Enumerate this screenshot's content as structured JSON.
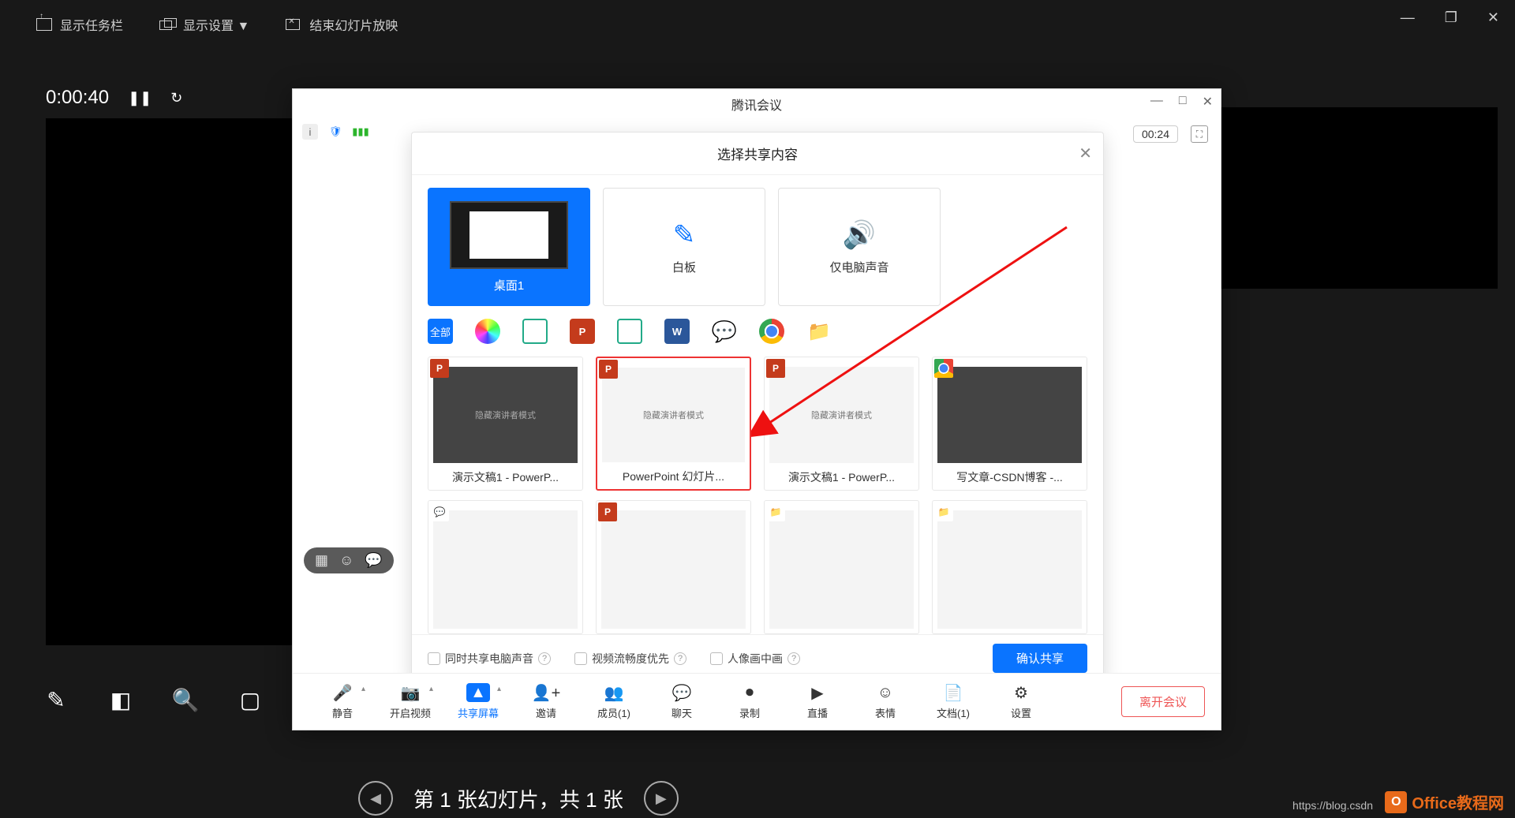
{
  "ppt": {
    "show_taskbar": "显示任务栏",
    "display_settings": "显示设置 ▼",
    "end_show": "结束幻灯片放映",
    "timer": "0:00:40",
    "slide_count": "第 1 张幻灯片，共 1 张"
  },
  "window_controls": {
    "min": "—",
    "max": "❐",
    "close": "✕"
  },
  "meeting": {
    "title": "腾讯会议",
    "timer": "00:24",
    "dialog": {
      "title": "选择共享内容",
      "options": {
        "desktop": "桌面1",
        "whiteboard": "白板",
        "audio_only": "仅电脑声音"
      },
      "filter_all": "全部",
      "windows": [
        {
          "label": "演示文稿1 - PowerP...",
          "badge": "ppt",
          "thumb": "隐藏演讲者模式",
          "style": "dark"
        },
        {
          "label": "PowerPoint 幻灯片...",
          "badge": "ppt",
          "thumb": "隐藏演讲者模式",
          "style": "white",
          "highlight": true
        },
        {
          "label": "演示文稿1 - PowerP...",
          "badge": "ppt",
          "thumb": "隐藏演讲者模式",
          "style": "white"
        },
        {
          "label": "写文章-CSDN博客 -...",
          "badge": "chrome",
          "thumb": "",
          "style": "dark"
        },
        {
          "label": "",
          "badge": "wechat",
          "thumb": "",
          "style": "white"
        },
        {
          "label": "",
          "badge": "ppt",
          "thumb": "",
          "style": "white"
        },
        {
          "label": "",
          "badge": "folder",
          "thumb": "",
          "style": "white"
        },
        {
          "label": "",
          "badge": "folder",
          "thumb": "",
          "style": "white"
        }
      ],
      "chk_audio": "同时共享电脑声音",
      "chk_fluency": "视频流畅度优先",
      "chk_pip": "人像画中画",
      "confirm": "确认共享"
    },
    "footer": {
      "mute": "静音",
      "video": "开启视频",
      "share": "共享屏幕",
      "invite": "邀请",
      "members": "成员(1)",
      "chat": "聊天",
      "record": "录制",
      "live": "直播",
      "emoji": "表情",
      "docs": "文档(1)",
      "settings": "设置",
      "leave": "离开会议"
    }
  },
  "watermark": {
    "text": "Office教程网",
    "url": "https://blog.csdn"
  }
}
